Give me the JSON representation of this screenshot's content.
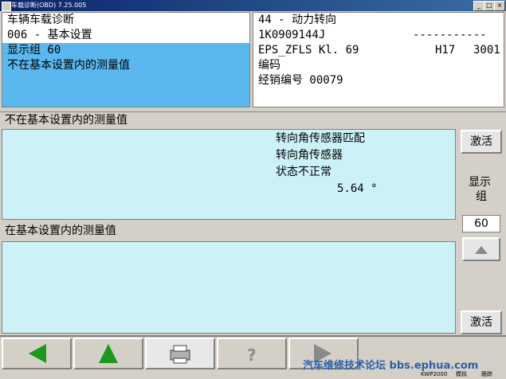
{
  "window": {
    "title": "车载诊断(OBD) 7.25.005"
  },
  "top_left": {
    "line1": "车辆车载诊断",
    "line2": "006 - 基本设置",
    "line3": "显示组 60",
    "line4": "不在基本设置内的测量值"
  },
  "top_right": {
    "module": "44 - 动力转向",
    "part_no": "1K0909144J",
    "dashes": "-----------",
    "component": "EPS_ZFLS Kl. 69",
    "hw": "H17",
    "sw": "3001",
    "coding_label": "编码",
    "dealer_label": "经销编号 00079"
  },
  "section_not_basic": {
    "header": "不在基本设置内的测量值",
    "values": [
      "转向角传感器匹配",
      "转向角传感器",
      "状态不正常",
      "5.64 °"
    ]
  },
  "section_basic": {
    "header": "在基本设置内的测量值"
  },
  "side": {
    "activate_label": "激活",
    "group_label_1": "显示",
    "group_label_2": "组",
    "group_value": "60",
    "activate_label_2": "激活"
  },
  "nav": {
    "print_icon": "printer-icon",
    "help_icon": "help-icon"
  },
  "status_bar": {
    "watermark": "汽车维修技术论坛 bbs.ephua.com",
    "kwp": "KWP2000",
    "item2": "模拟",
    "item3": "跟踪"
  },
  "colors": {
    "panel": "#ccf2f8",
    "selected": "#5ab8ef",
    "arrow_green": "#1a9a1a",
    "arrow_gray": "#8a8a8a"
  }
}
